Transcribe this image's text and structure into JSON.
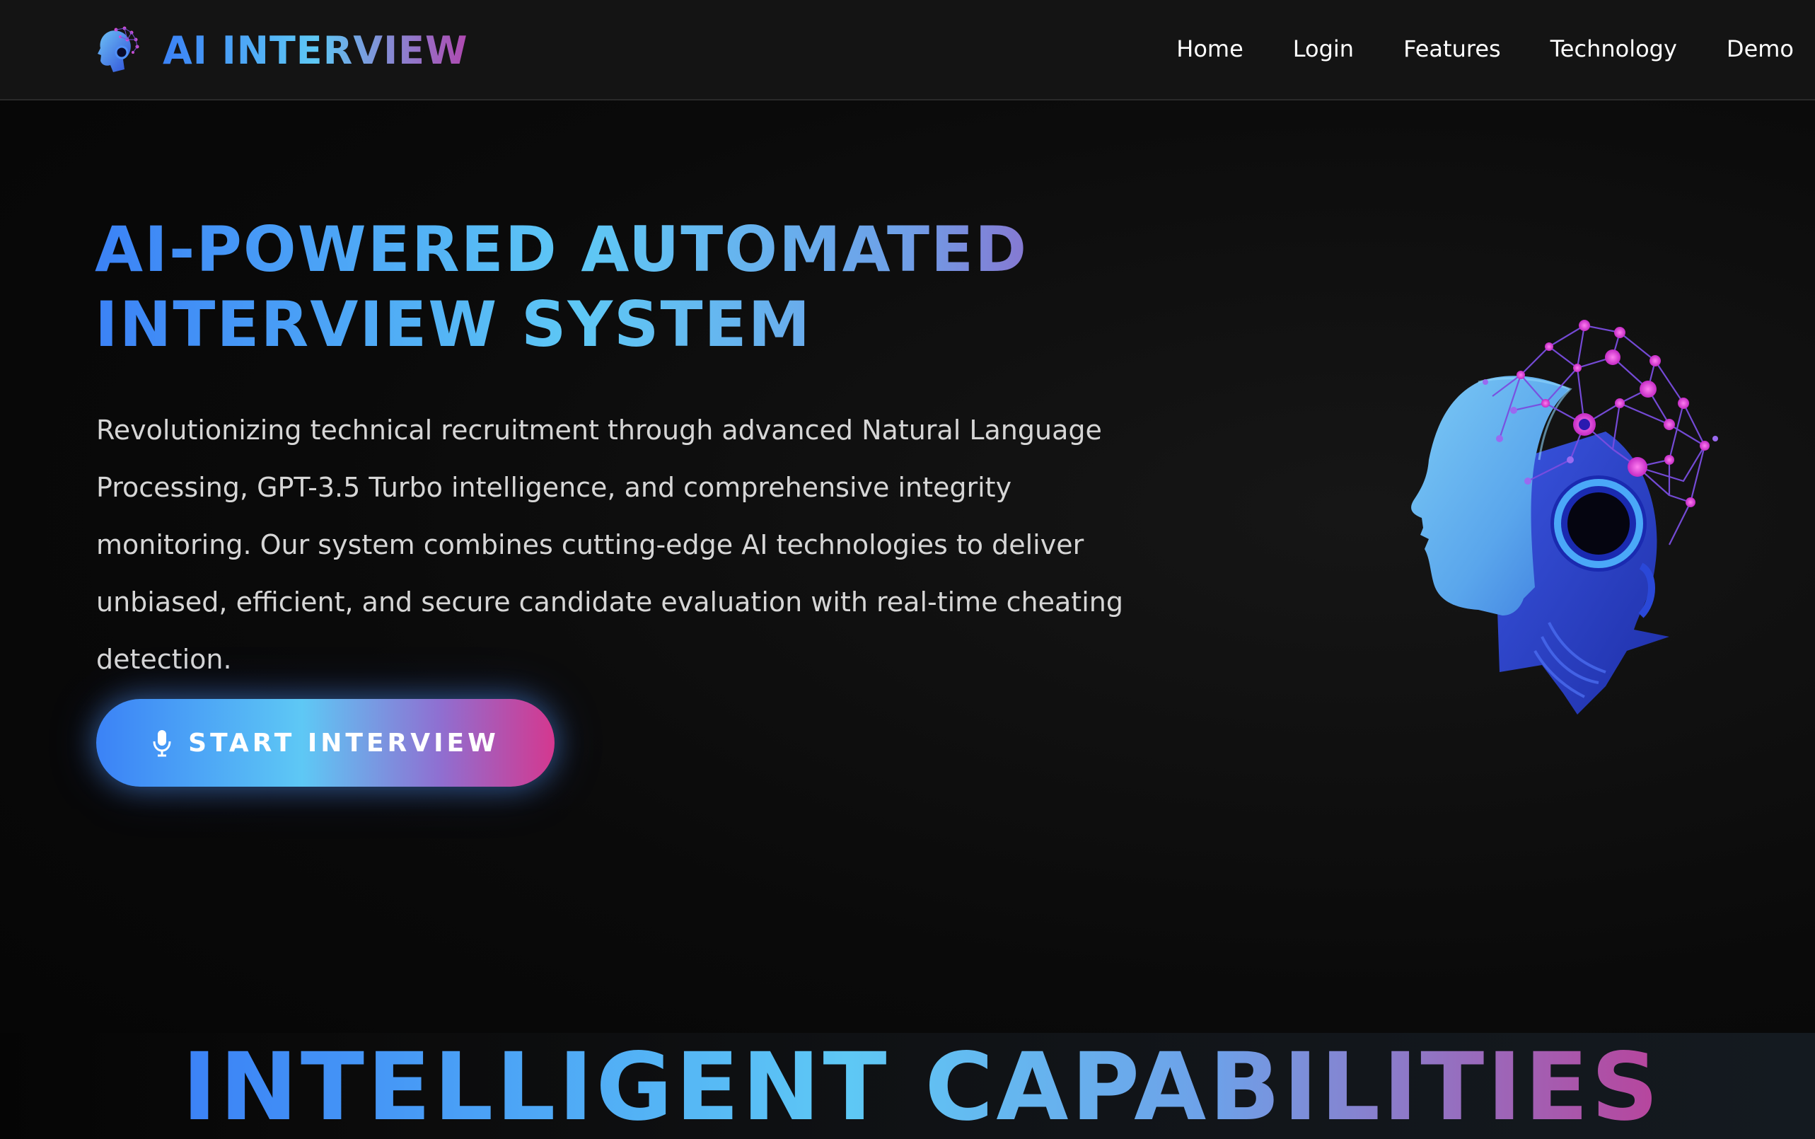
{
  "brand": {
    "name": "AI INTERVIEW",
    "logo_icon": "ai-head-logo-icon"
  },
  "nav": {
    "items": [
      {
        "label": "Home"
      },
      {
        "label": "Login"
      },
      {
        "label": "Features"
      },
      {
        "label": "Technology"
      },
      {
        "label": "Demo"
      }
    ]
  },
  "hero": {
    "title_line1": "AI-POWERED AUTOMATED",
    "title_line2": "INTERVIEW SYSTEM",
    "description": "Revolutionizing technical recruitment through advanced Natural Language Processing, GPT-3.5 Turbo intelligence, and comprehensive integrity monitoring. Our system combines cutting-edge AI technologies to deliver unbiased, efficient, and secure candidate evaluation with real-time cheating detection.",
    "cta_label": "START INTERVIEW",
    "cta_icon": "microphone-icon",
    "image_icon": "ai-robot-head-illustration"
  },
  "section": {
    "title": "INTELLIGENT CAPABILITIES"
  },
  "colors": {
    "accent_blue": "#3b82f6",
    "accent_cyan": "#5ec8f5",
    "accent_purple": "#a04cb8",
    "accent_pink": "#d4388f",
    "background": "#050505",
    "navbar": "#141414"
  }
}
